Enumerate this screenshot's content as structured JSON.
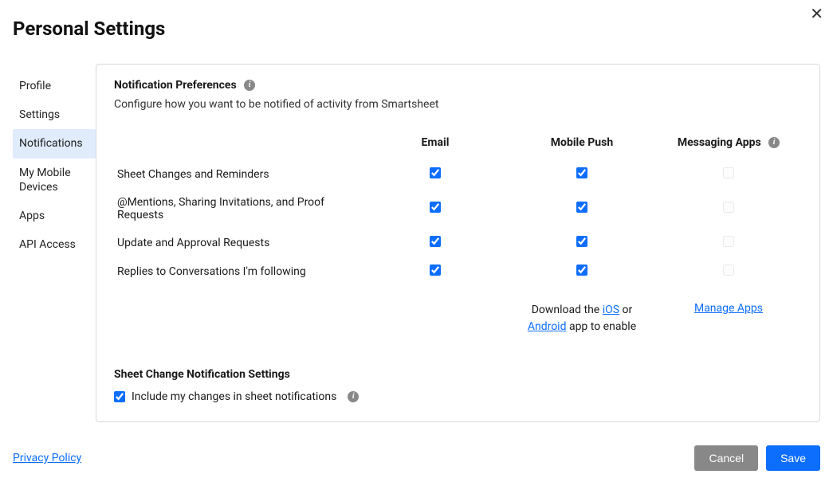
{
  "page_title": "Personal Settings",
  "sidebar": {
    "items": [
      {
        "label": "Profile",
        "active": false
      },
      {
        "label": "Settings",
        "active": false
      },
      {
        "label": "Notifications",
        "active": true
      },
      {
        "label": "My Mobile Devices",
        "active": false
      },
      {
        "label": "Apps",
        "active": false
      },
      {
        "label": "API Access",
        "active": false
      }
    ]
  },
  "main": {
    "section_title": "Notification Preferences",
    "description": "Configure how you want to be notified of activity from Smartsheet",
    "columns": {
      "label": "",
      "email": "Email",
      "mobile": "Mobile Push",
      "messaging": "Messaging Apps"
    },
    "rows": [
      {
        "label": "Sheet Changes and Reminders",
        "email": true,
        "mobile": true,
        "messaging": false,
        "messaging_enabled": false
      },
      {
        "label": "@Mentions, Sharing Invitations, and Proof Requests",
        "email": true,
        "mobile": true,
        "messaging": false,
        "messaging_enabled": false
      },
      {
        "label": "Update and Approval Requests",
        "email": true,
        "mobile": true,
        "messaging": false,
        "messaging_enabled": false
      },
      {
        "label": "Replies to Conversations I'm following",
        "email": true,
        "mobile": true,
        "messaging": false,
        "messaging_enabled": false
      }
    ],
    "download": {
      "prefix": "Download the ",
      "ios": "iOS",
      "or": " or ",
      "android": "Android",
      "suffix": " app to enable"
    },
    "manage_apps": "Manage Apps",
    "sheet_change_title": "Sheet Change Notification Settings",
    "include_label": "Include my changes in sheet notifications",
    "include_checked": true
  },
  "footer": {
    "privacy": "Privacy Policy",
    "cancel": "Cancel",
    "save": "Save"
  }
}
